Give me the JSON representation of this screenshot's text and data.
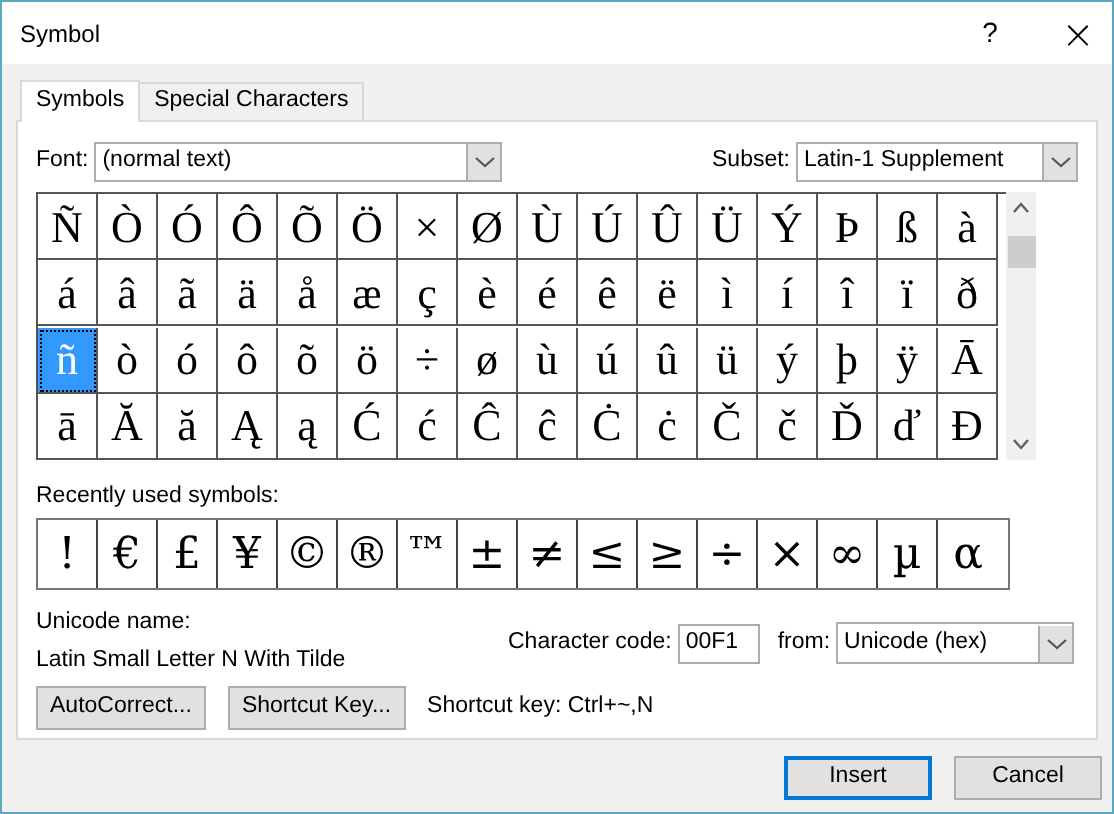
{
  "window": {
    "title": "Symbol",
    "help": "?",
    "close": "×"
  },
  "tabs": [
    {
      "label": "Symbols",
      "selected": true
    },
    {
      "label": "Special Characters",
      "selected": false
    }
  ],
  "font": {
    "label": "Font:",
    "value": "(normal text)"
  },
  "subset": {
    "label": "Subset:",
    "value": "Latin-1 Supplement"
  },
  "grid": [
    [
      {
        "char": "Ñ",
        "selected": false
      },
      {
        "char": "Ò",
        "selected": false
      },
      {
        "char": "Ó",
        "selected": false
      },
      {
        "char": "Ô",
        "selected": false
      },
      {
        "char": "Õ",
        "selected": false
      },
      {
        "char": "Ö",
        "selected": false
      },
      {
        "char": "×",
        "selected": false
      },
      {
        "char": "Ø",
        "selected": false
      },
      {
        "char": "Ù",
        "selected": false
      },
      {
        "char": "Ú",
        "selected": false
      },
      {
        "char": "Û",
        "selected": false
      },
      {
        "char": "Ü",
        "selected": false
      },
      {
        "char": "Ý",
        "selected": false
      },
      {
        "char": "Þ",
        "selected": false
      },
      {
        "char": "ß",
        "selected": false
      },
      {
        "char": "à",
        "selected": false
      }
    ],
    [
      {
        "char": "á",
        "selected": false
      },
      {
        "char": "â",
        "selected": false
      },
      {
        "char": "ã",
        "selected": false
      },
      {
        "char": "ä",
        "selected": false
      },
      {
        "char": "å",
        "selected": false
      },
      {
        "char": "æ",
        "selected": false
      },
      {
        "char": "ç",
        "selected": false
      },
      {
        "char": "è",
        "selected": false
      },
      {
        "char": "é",
        "selected": false
      },
      {
        "char": "ê",
        "selected": false
      },
      {
        "char": "ë",
        "selected": false
      },
      {
        "char": "ì",
        "selected": false
      },
      {
        "char": "í",
        "selected": false
      },
      {
        "char": "î",
        "selected": false
      },
      {
        "char": "ï",
        "selected": false
      },
      {
        "char": "ð",
        "selected": false
      }
    ],
    [
      {
        "char": "ñ",
        "selected": true
      },
      {
        "char": "ò",
        "selected": false
      },
      {
        "char": "ó",
        "selected": false
      },
      {
        "char": "ô",
        "selected": false
      },
      {
        "char": "õ",
        "selected": false
      },
      {
        "char": "ö",
        "selected": false
      },
      {
        "char": "÷",
        "selected": false
      },
      {
        "char": "ø",
        "selected": false
      },
      {
        "char": "ù",
        "selected": false
      },
      {
        "char": "ú",
        "selected": false
      },
      {
        "char": "û",
        "selected": false
      },
      {
        "char": "ü",
        "selected": false
      },
      {
        "char": "ý",
        "selected": false
      },
      {
        "char": "þ",
        "selected": false
      },
      {
        "char": "ÿ",
        "selected": false
      },
      {
        "char": "Ā",
        "selected": false
      }
    ],
    [
      {
        "char": "ā",
        "selected": false
      },
      {
        "char": "Ă",
        "selected": false
      },
      {
        "char": "ă",
        "selected": false
      },
      {
        "char": "Ą",
        "selected": false
      },
      {
        "char": "ą",
        "selected": false
      },
      {
        "char": "Ć",
        "selected": false
      },
      {
        "char": "ć",
        "selected": false
      },
      {
        "char": "Ĉ",
        "selected": false
      },
      {
        "char": "ĉ",
        "selected": false
      },
      {
        "char": "Ċ",
        "selected": false
      },
      {
        "char": "ċ",
        "selected": false
      },
      {
        "char": "Č",
        "selected": false
      },
      {
        "char": "č",
        "selected": false
      },
      {
        "char": "Ď",
        "selected": false
      },
      {
        "char": "ď",
        "selected": false
      },
      {
        "char": "Đ",
        "selected": false
      }
    ]
  ],
  "recent": {
    "label": "Recently used symbols:",
    "symbols": [
      "!",
      "€",
      "£",
      "¥",
      "©",
      "®",
      "™",
      "±",
      "≠",
      "≤",
      "≥",
      "÷",
      "×",
      "∞",
      "µ",
      "α"
    ]
  },
  "unicode_name": {
    "label": "Unicode name:",
    "value": "Latin Small Letter N With Tilde"
  },
  "character_code": {
    "label": "Character code:",
    "value": "00F1"
  },
  "from": {
    "label": "from:",
    "value": "Unicode (hex)"
  },
  "buttons": [
    {
      "label": "AutoCorrect..."
    },
    {
      "label": "Shortcut Key..."
    }
  ],
  "shortcut_text": "Shortcut key: Ctrl+~,N",
  "footer_buttons": [
    {
      "label": "Insert",
      "default": true
    },
    {
      "label": "Cancel",
      "default": false
    }
  ]
}
